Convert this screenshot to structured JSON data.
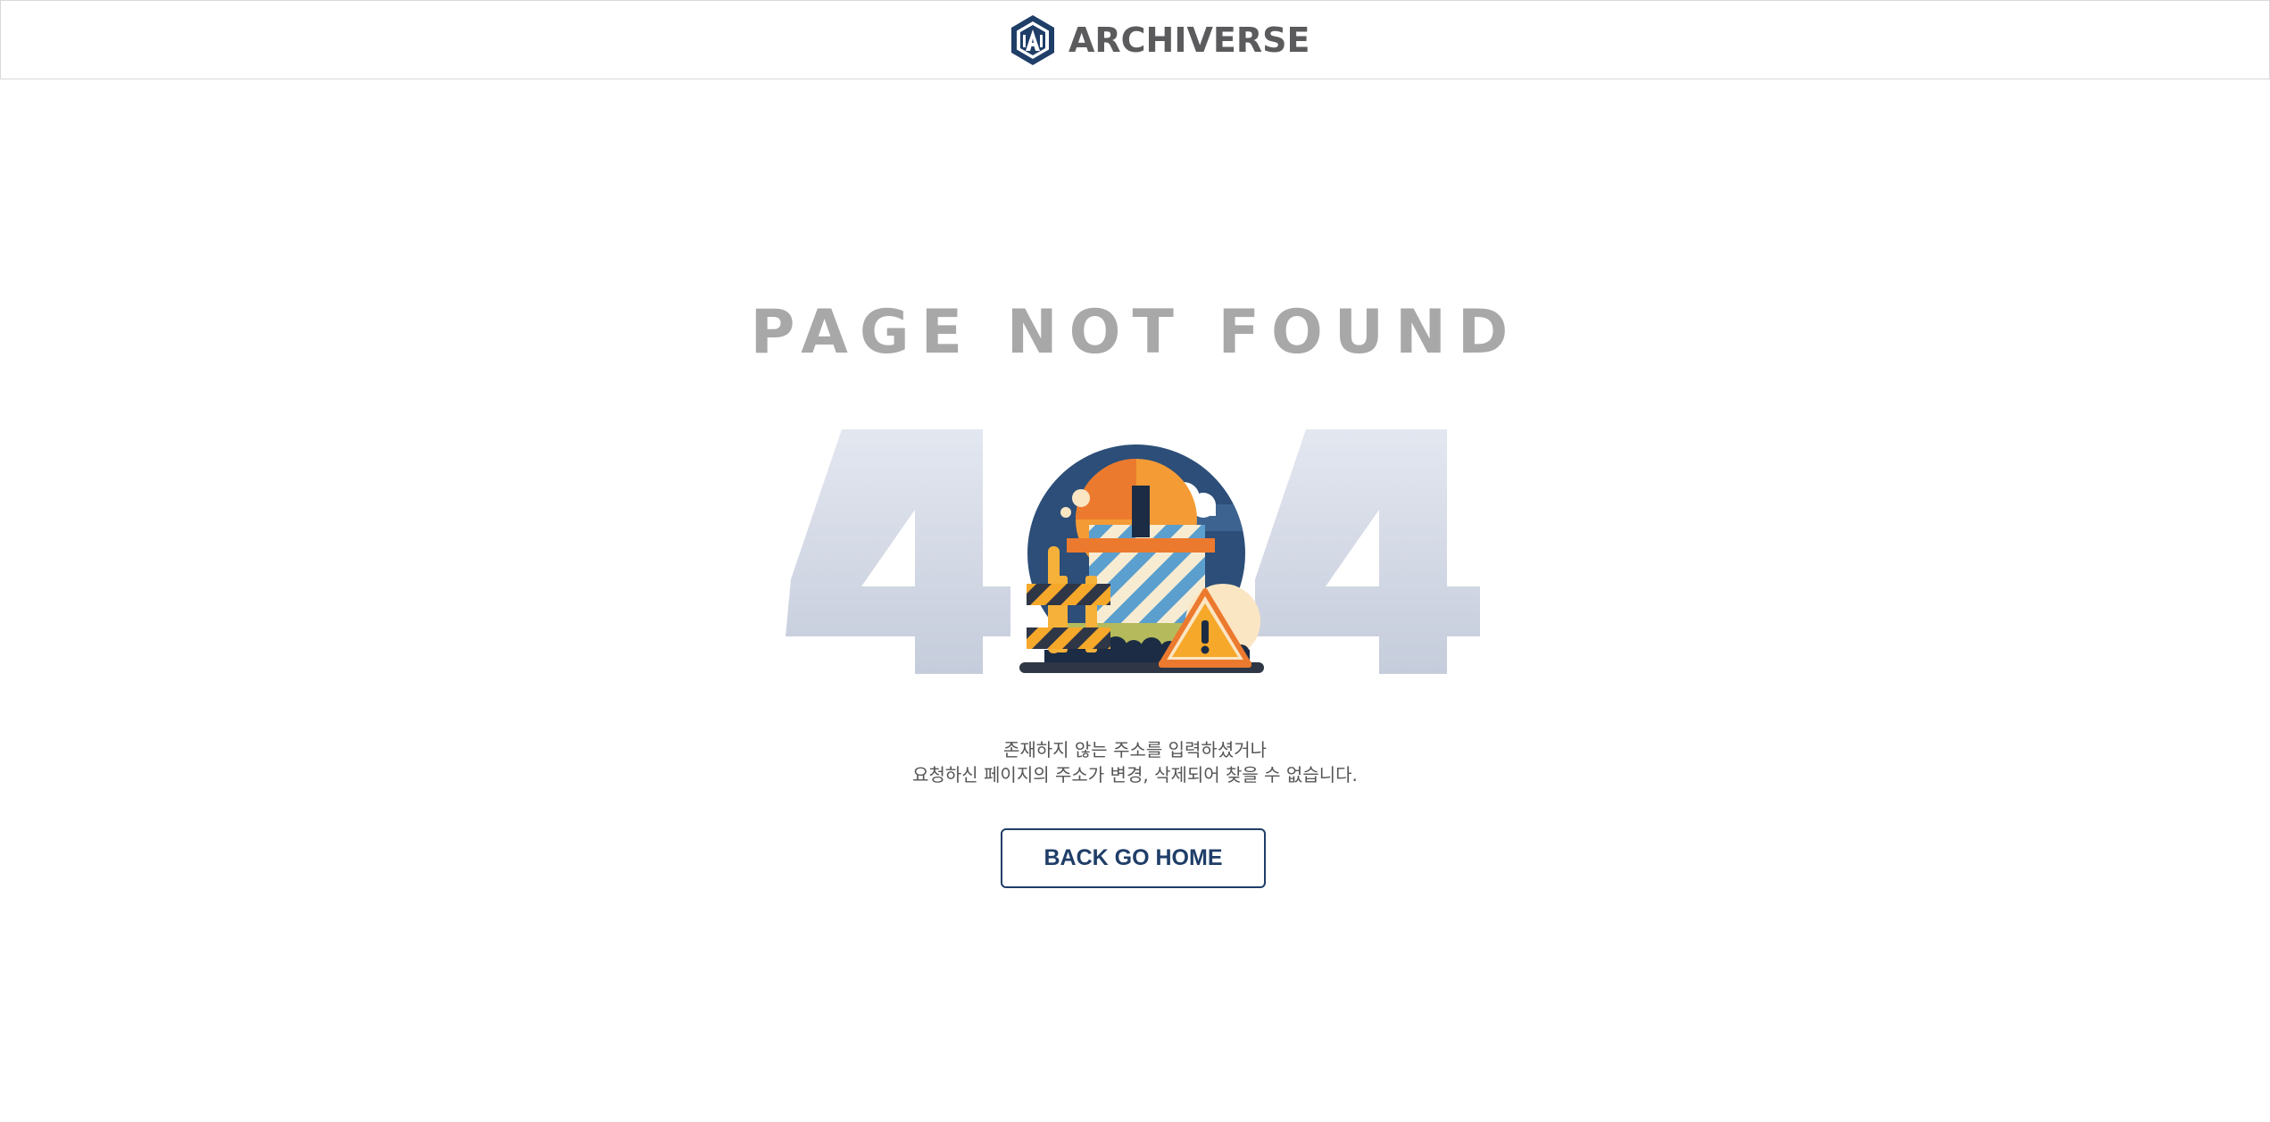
{
  "header": {
    "brand": "ARCHIVERSE",
    "brand_color": "#5b5b5d",
    "logo_icon": "hexagon-a-logo-icon"
  },
  "main": {
    "title": "PAGE NOT FOUND",
    "code_left": "4",
    "code_right": "4",
    "illustration": "under-construction-icon",
    "message_line1": "존재하지 않는 주소를 입력하셨거나",
    "message_line2": "요청하신 페이지의 주소가 변경, 삭제되어 찾을 수 없습니다.",
    "home_button": "BACK GO HOME"
  },
  "colors": {
    "accent": "#1f3e68",
    "title": "#a8a8a8",
    "digits": "#c8cfdd",
    "text": "#555555"
  }
}
